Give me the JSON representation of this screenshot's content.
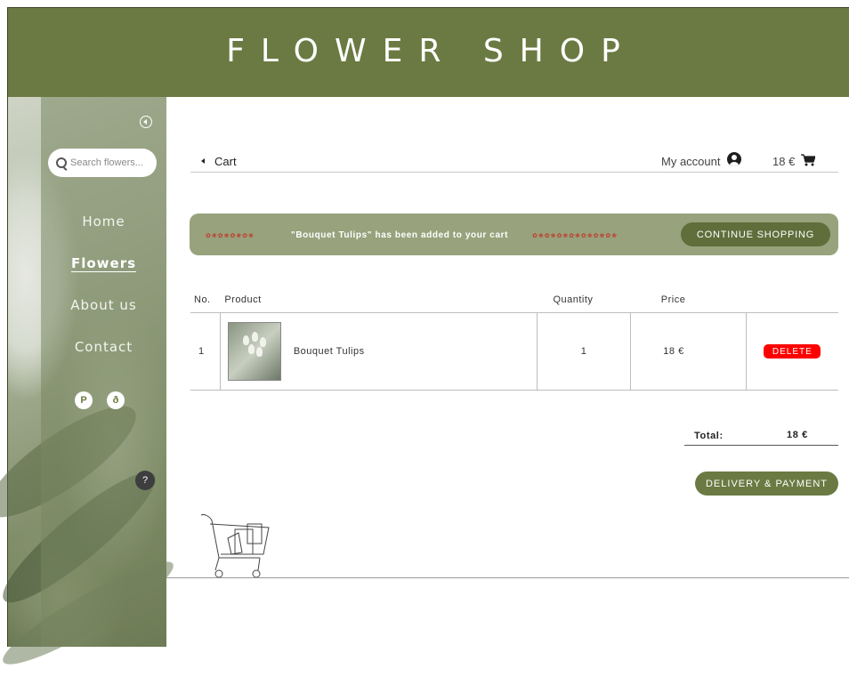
{
  "header": {
    "title": "FLOWER SHOP"
  },
  "sidebar": {
    "search_placeholder": "Search flowers...",
    "nav": [
      {
        "label": "Home",
        "active": false
      },
      {
        "label": "Flowers",
        "active": true
      },
      {
        "label": "About us",
        "active": false
      },
      {
        "label": "Contact",
        "active": false
      }
    ],
    "social": [
      "P",
      "ð"
    ],
    "help_label": "?"
  },
  "topbar": {
    "breadcrumb": "Cart",
    "account_label": "My account",
    "cart_total": "18 €"
  },
  "banner": {
    "message": "\"Bouquet Tulips\" has been added to your cart",
    "continue_label": "CONTINUE SHOPPING"
  },
  "cart_table": {
    "headers": {
      "no": "No.",
      "product": "Product",
      "quantity": "Quantity",
      "price": "Price"
    },
    "rows": [
      {
        "no": "1",
        "product": "Bouquet Tulips",
        "quantity": "1",
        "price": "18 €",
        "delete_label": "DELETE"
      }
    ]
  },
  "summary": {
    "total_label": "Total:",
    "total_value": "18 €",
    "delivery_label": "DELIVERY & PAYMENT"
  },
  "colors": {
    "brand_green": "#6b7a42",
    "banner_green": "#98a27c",
    "delete_red": "#ff0000"
  },
  "icons": [
    "collapse-icon",
    "search-icon",
    "back-icon",
    "user-icon",
    "cart-icon",
    "cart-illustration"
  ]
}
